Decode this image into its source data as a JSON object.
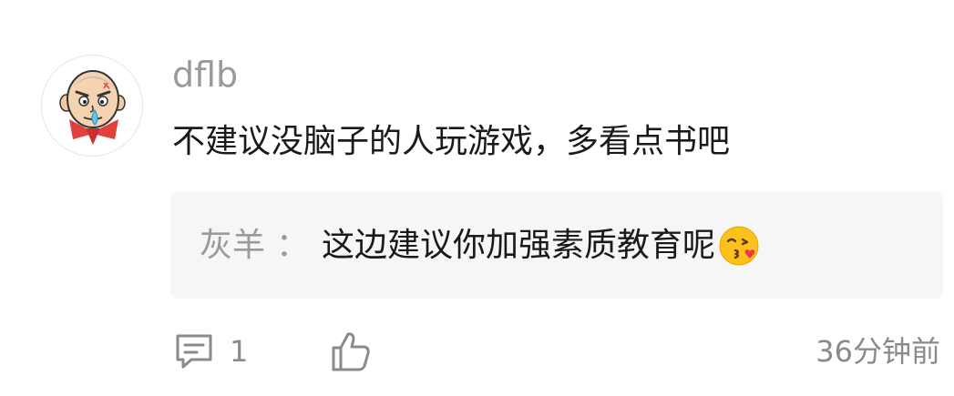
{
  "comment": {
    "username": "dflb",
    "text": "不建议没脑子的人玩游戏，多看点书吧",
    "avatar_icon": "cartoon-avatar-icon"
  },
  "reply": {
    "author": "灰羊",
    "separator": "：",
    "text": "这边建议你加强素质教育呢",
    "emoji_icon": "kissing-face-emoji-icon"
  },
  "actions": {
    "comment_icon": "comment-icon",
    "comment_count": "1",
    "like_icon": "thumbs-up-icon",
    "timestamp": "36分钟前"
  },
  "colors": {
    "meta_gray": "#9a9a9a",
    "reply_bg": "#f6f6f6",
    "text_dark": "#1a1a1a"
  }
}
